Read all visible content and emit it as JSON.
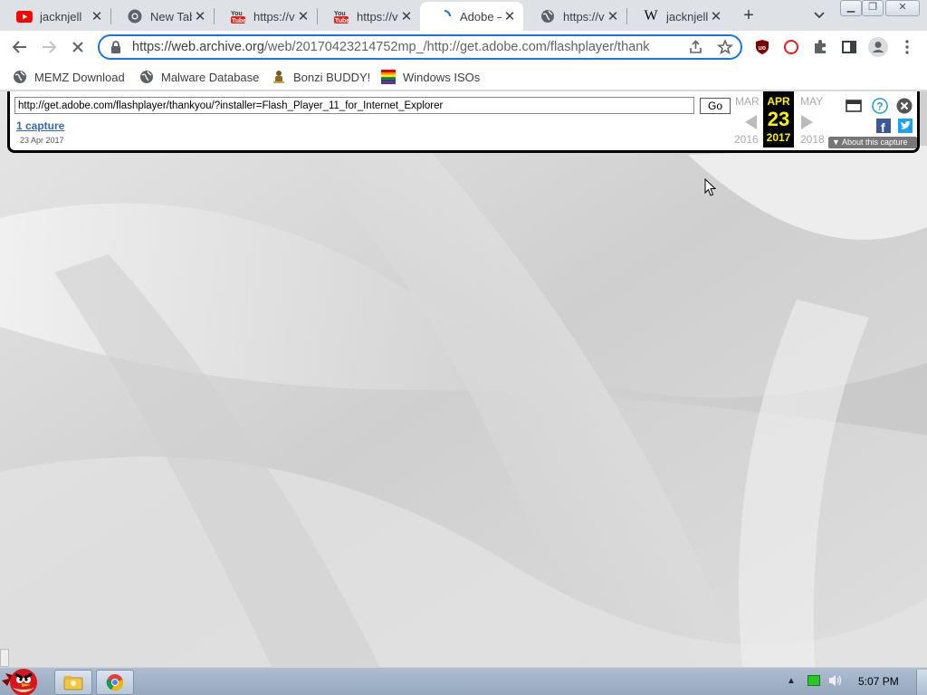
{
  "tabs": [
    {
      "title": "jacknjell",
      "icon": "youtube-icon"
    },
    {
      "title": "New Tab",
      "icon": "chrome-icon"
    },
    {
      "title": "https://v",
      "icon": "youtube-tube-icon"
    },
    {
      "title": "https://v",
      "icon": "youtube-tube-icon"
    },
    {
      "title": "Adobe –",
      "icon": "loading-spinner-icon"
    },
    {
      "title": "https://v",
      "icon": "globe-icon"
    },
    {
      "title": "jacknjell",
      "icon": "wikipedia-icon"
    }
  ],
  "active_tab_index": 4,
  "omnibox": {
    "host": "https://web.archive.org",
    "path": "/web/20170423214752mp_/http://get.adobe.com/flashplayer/thank"
  },
  "bookmarks": [
    {
      "label": "MEMZ Download",
      "icon": "globe-icon"
    },
    {
      "label": "Malware Database",
      "icon": "globe-icon"
    },
    {
      "label": "Bonzi BUDDY!",
      "icon": "bonzi-icon"
    },
    {
      "label": "Windows ISOs",
      "icon": "windows-flag-icon"
    }
  ],
  "wayback": {
    "url_value": "http://get.adobe.com/flashplayer/thankyou/?installer=Flash_Player_11_for_Internet_Explorer",
    "go_label": "Go",
    "captures_label": "1 capture",
    "capture_date": "23 Apr 2017",
    "prev_month": "MAR",
    "cur_month": "APR",
    "next_month": "MAY",
    "cur_day": "23",
    "prev_year": "2016",
    "cur_year": "2017",
    "next_year": "2018",
    "about_label": "About this capture"
  },
  "taskbar": {
    "time": "5:07 PM"
  },
  "colors": {
    "accent": "#1a73e8",
    "wayback_highlight": "#ffef00",
    "link": "#3366cc"
  }
}
